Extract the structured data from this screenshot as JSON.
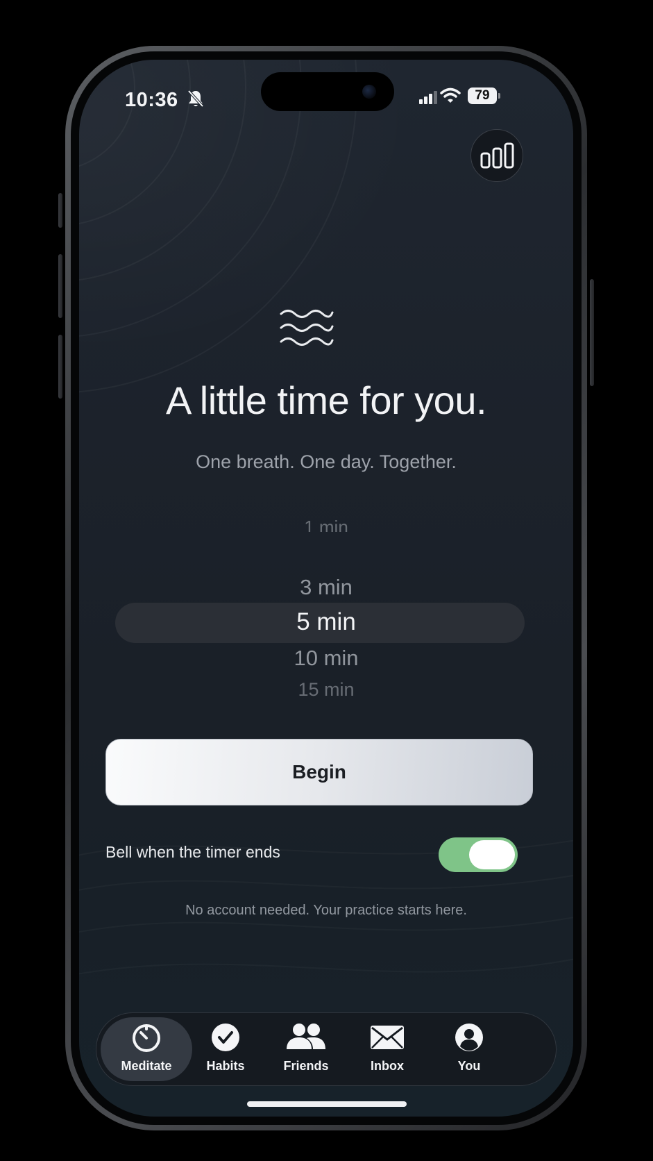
{
  "status_bar": {
    "time": "10:36",
    "battery": "79",
    "icons": [
      "bell-off-icon",
      "signal-icon",
      "wifi-icon",
      "battery-icon"
    ]
  },
  "header": {
    "stats_icon": "bar-chart-icon"
  },
  "hero": {
    "icon": "waves-icon",
    "title": "A little time for you.",
    "subtitle": "One breath. One day. Together."
  },
  "duration_picker": {
    "options": [
      "1 min",
      "3 min",
      "5 min",
      "10 min",
      "15 min"
    ],
    "selected": "5 min"
  },
  "begin_button": {
    "label": "Begin"
  },
  "bell_setting": {
    "label": "Bell when the timer ends",
    "enabled": true
  },
  "footnote": "No account needed. Your practice starts here.",
  "tab_bar": {
    "tabs": [
      {
        "label": "Meditate",
        "icon": "timer-icon",
        "active": true
      },
      {
        "label": "Habits",
        "icon": "checkmark-icon",
        "active": false
      },
      {
        "label": "Friends",
        "icon": "people-icon",
        "active": false
      },
      {
        "label": "Inbox",
        "icon": "envelope-icon",
        "active": false
      },
      {
        "label": "You",
        "icon": "person-icon",
        "active": false
      }
    ]
  },
  "colors": {
    "background": "#1c222b",
    "toggle_on": "#7fc488",
    "primary_text": "#f2f3f5",
    "secondary_text": "#9ea3ab"
  }
}
